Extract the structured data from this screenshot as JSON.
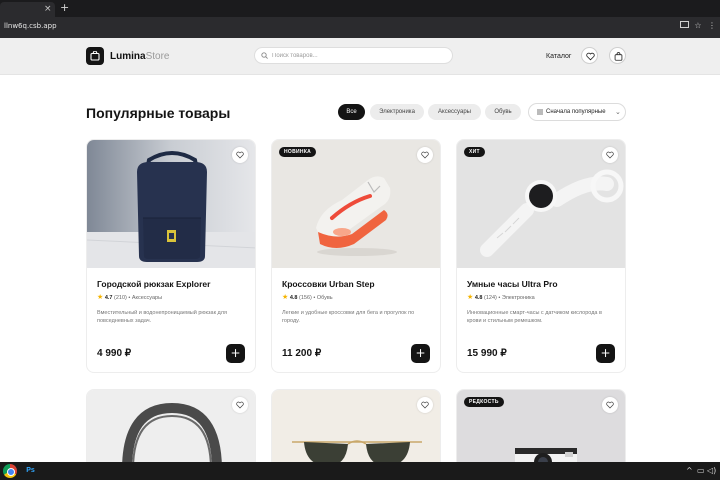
{
  "browser": {
    "tab_close": "×",
    "new_tab": "+",
    "url": "llnw6q.csb.app"
  },
  "header": {
    "logo_main": "Lumina",
    "logo_accent": "Store",
    "search_placeholder": "Поиск товаров...",
    "catalog_label": "Каталог"
  },
  "section": {
    "title": "Популярные товары",
    "filters": [
      "Все",
      "Электроника",
      "Аксессуары",
      "Обувь"
    ],
    "active_filter": "Все",
    "sort_label": "Сначала популярные"
  },
  "products": [
    {
      "badge": "",
      "title": "Городской рюкзак Explorer",
      "rating": "4.7",
      "reviews": "(210)",
      "category": "Аксессуары",
      "description": "Вместительный и водонепроницаемый рюкзак для повседневных задач.",
      "price": "4 990 ₽"
    },
    {
      "badge": "НОВИНКА",
      "title": "Кроссовки Urban Step",
      "rating": "4.8",
      "reviews": "(156)",
      "category": "Обувь",
      "description": "Легкие и удобные кроссовки для бега и прогулок по городу.",
      "price": "11 200 ₽"
    },
    {
      "badge": "ХИТ",
      "title": "Умные часы Ultra Pro",
      "rating": "4.8",
      "reviews": "(124)",
      "category": "Электроника",
      "description": "Инновационные смарт-часы с датчиком кислорода в крови и стильным ремешком.",
      "price": "15 990 ₽"
    },
    {
      "badge": ""
    },
    {
      "badge": ""
    },
    {
      "badge": "РЕДКОСТЬ"
    }
  ],
  "icons": {
    "star": "★",
    "cart_plus": "+",
    "sort_chevron": "⌄"
  },
  "taskbar": {
    "ps_label": "Ps",
    "tray_chevron": "^",
    "tray_monitor": "▭",
    "tray_volume": "◁)"
  },
  "colors": {
    "accent": "#141414",
    "star": "#f5b400",
    "header_bg": "#efefef"
  }
}
